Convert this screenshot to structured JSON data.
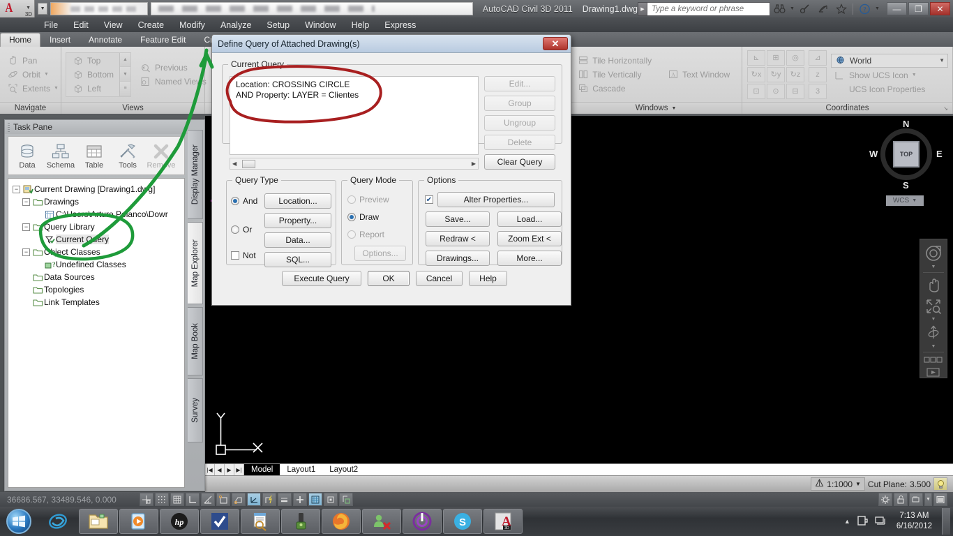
{
  "titlebar": {
    "app_title": "AutoCAD Civil 3D 2011",
    "document": "Drawing1.dwg",
    "logo_label": "3D",
    "search_placeholder": "Type a keyword or phrase",
    "icons": [
      "search-binoculars-icon",
      "communication-center-icon",
      "favorites-star-icon",
      "help-question-icon"
    ],
    "window_buttons": [
      "minimize",
      "restore",
      "close"
    ]
  },
  "menubar": {
    "items": [
      "File",
      "Edit",
      "View",
      "Create",
      "Modify",
      "Analyze",
      "Setup",
      "Window",
      "Help",
      "Express"
    ]
  },
  "ribbon": {
    "tabs": [
      "Home",
      "Insert",
      "Annotate",
      "Feature Edit",
      "Create"
    ],
    "active_tab": "Home",
    "panels": [
      {
        "title": "Navigate",
        "items": [
          "Pan",
          "Orbit",
          "Extents"
        ]
      },
      {
        "title": "Views",
        "items": [
          "Top",
          "Bottom",
          "Left",
          "Previous",
          "Named Views"
        ]
      },
      {
        "title": "Windows",
        "items": [
          "Tile Horizontally",
          "Tile Vertically",
          "Cascade",
          "Text Window"
        ]
      },
      {
        "title": "Coordinates",
        "items": [
          "World",
          "Show UCS Icon",
          "UCS Icon Properties"
        ]
      }
    ],
    "coordinate_system": "World"
  },
  "taskpane": {
    "title": "Task Pane",
    "toolbar": [
      {
        "label": "Data",
        "enabled": true
      },
      {
        "label": "Schema",
        "enabled": true
      },
      {
        "label": "Table",
        "enabled": true
      },
      {
        "label": "Tools",
        "enabled": true
      },
      {
        "label": "Remove",
        "enabled": false
      }
    ],
    "tree": [
      {
        "label": "Current Drawing [Drawing1.dwg]",
        "indent": 0,
        "toggle": "-",
        "icon": "drawing-icon"
      },
      {
        "label": "Drawings",
        "indent": 1,
        "toggle": "-",
        "icon": "folder-icon"
      },
      {
        "label": "C:\\Users\\Arturo Polanco\\Dowr",
        "indent": 2,
        "toggle": "",
        "icon": "dwg-file-icon"
      },
      {
        "label": "Query Library",
        "indent": 1,
        "toggle": "-",
        "icon": "folder-icon"
      },
      {
        "label": "Current Query",
        "indent": 2,
        "toggle": "",
        "icon": "query-icon",
        "selected": true
      },
      {
        "label": "Object Classes",
        "indent": 1,
        "toggle": "-",
        "icon": "folder-icon"
      },
      {
        "label": "Undefined Classes",
        "indent": 2,
        "toggle": "",
        "icon": "class-icon"
      },
      {
        "label": "Data Sources",
        "indent": 1,
        "toggle": "",
        "icon": "folder-icon"
      },
      {
        "label": "Topologies",
        "indent": 1,
        "toggle": "",
        "icon": "folder-icon"
      },
      {
        "label": "Link Templates",
        "indent": 1,
        "toggle": "",
        "icon": "folder-icon"
      }
    ],
    "vertical_tabs": [
      {
        "label": "Display Manager",
        "active": false
      },
      {
        "label": "Map Explorer",
        "active": true
      },
      {
        "label": "Map Book",
        "active": false
      },
      {
        "label": "Survey",
        "active": false
      }
    ]
  },
  "dialog": {
    "title": "Define Query of Attached Drawing(s)",
    "current_query": {
      "legend": "Current Query",
      "lines": [
        "        Location: CROSSING CIRCLE",
        "AND  Property: LAYER = Clientes"
      ],
      "side_buttons": [
        {
          "label": "Edit...",
          "enabled": false
        },
        {
          "label": "Group",
          "enabled": false
        },
        {
          "label": "Ungroup",
          "enabled": false
        },
        {
          "label": "Delete",
          "enabled": false
        },
        {
          "label": "Clear Query",
          "enabled": true
        }
      ]
    },
    "query_type": {
      "legend": "Query Type",
      "radios": [
        {
          "label": "And",
          "checked": true
        },
        {
          "label": "Or",
          "checked": false
        }
      ],
      "checkbox": {
        "label": "Not",
        "checked": false
      },
      "buttons": [
        "Location...",
        "Property...",
        "Data...",
        "SQL..."
      ]
    },
    "query_mode": {
      "legend": "Query Mode",
      "radios": [
        {
          "label": "Preview",
          "checked": false
        },
        {
          "label": "Draw",
          "checked": true
        },
        {
          "label": "Report",
          "checked": false
        }
      ],
      "options_button": {
        "label": "Options...",
        "enabled": false
      }
    },
    "options": {
      "legend": "Options",
      "alter_properties": {
        "label": "Alter Properties...",
        "checked": true
      },
      "buttons": [
        "Save...",
        "Load...",
        "Redraw <",
        "Zoom Ext <",
        "Drawings...",
        "More..."
      ]
    },
    "action_buttons": [
      "Execute Query",
      "OK",
      "Cancel",
      "Help"
    ]
  },
  "canvas": {
    "viewcube": {
      "face": "TOP",
      "compass": {
        "north": "N",
        "south": "S",
        "east": "E",
        "west": "W"
      },
      "ucs_label": "WCS"
    },
    "ucs_icon": {
      "x_label": "X",
      "y_label": "Y"
    },
    "navbar_icons": [
      "steering-wheel-icon",
      "pan-icon",
      "zoom-extents-icon",
      "orbit-icon",
      "show-motion-icon"
    ],
    "entity_color": "#cc33cc"
  },
  "model_tabs": {
    "nav_buttons": [
      "first",
      "previous",
      "next",
      "last"
    ],
    "tabs": [
      {
        "label": "Model",
        "active": true
      },
      {
        "label": "Layout1",
        "active": false
      },
      {
        "label": "Layout2",
        "active": false
      }
    ]
  },
  "status_bar": {
    "scale": "1:1000",
    "cut_plane_label": "Cut Plane:",
    "cut_plane_value": "3.500"
  },
  "bottom_bar": {
    "coordinates": "36686.567, 33489.546, 0.000",
    "toggles": [
      "snap-icon",
      "grid-display-icon",
      "grid-snap-icon",
      "ortho-icon",
      "polar-icon",
      "osnap-icon",
      "otrack-icon",
      "ducs-icon",
      "dyn-icon",
      "lineweight-icon",
      "transparency-icon",
      "quick-properties-icon",
      "selection-cycling-icon"
    ],
    "right_icons": [
      "settings-gear-icon",
      "unlock-icon",
      "hardware-accel-icon",
      "expand-icon",
      "clean-screen-icon"
    ]
  },
  "taskbar": {
    "start_label": "Start",
    "items": [
      "internet-explorer-icon",
      "windows-explorer-icon",
      "media-player-icon",
      "hp-icon",
      "checkmark-app-icon",
      "document-viewer-icon",
      "security-app-icon",
      "firefox-icon",
      "messenger-icon",
      "bittorrent-icon",
      "skype-icon",
      "autocad-icon"
    ],
    "tray_icons": [
      "show-hidden-icon",
      "power-icon",
      "network-icon"
    ],
    "time": "7:13 AM",
    "date": "6/16/2012"
  },
  "annotations": {
    "red_circle_color": "#a81f20",
    "green_circle_color": "#1e9b3a"
  },
  "colors": {
    "accent_blue": "#2a6fb0",
    "dialog_bg": "#efefef",
    "canvas_bg": "#000000"
  }
}
